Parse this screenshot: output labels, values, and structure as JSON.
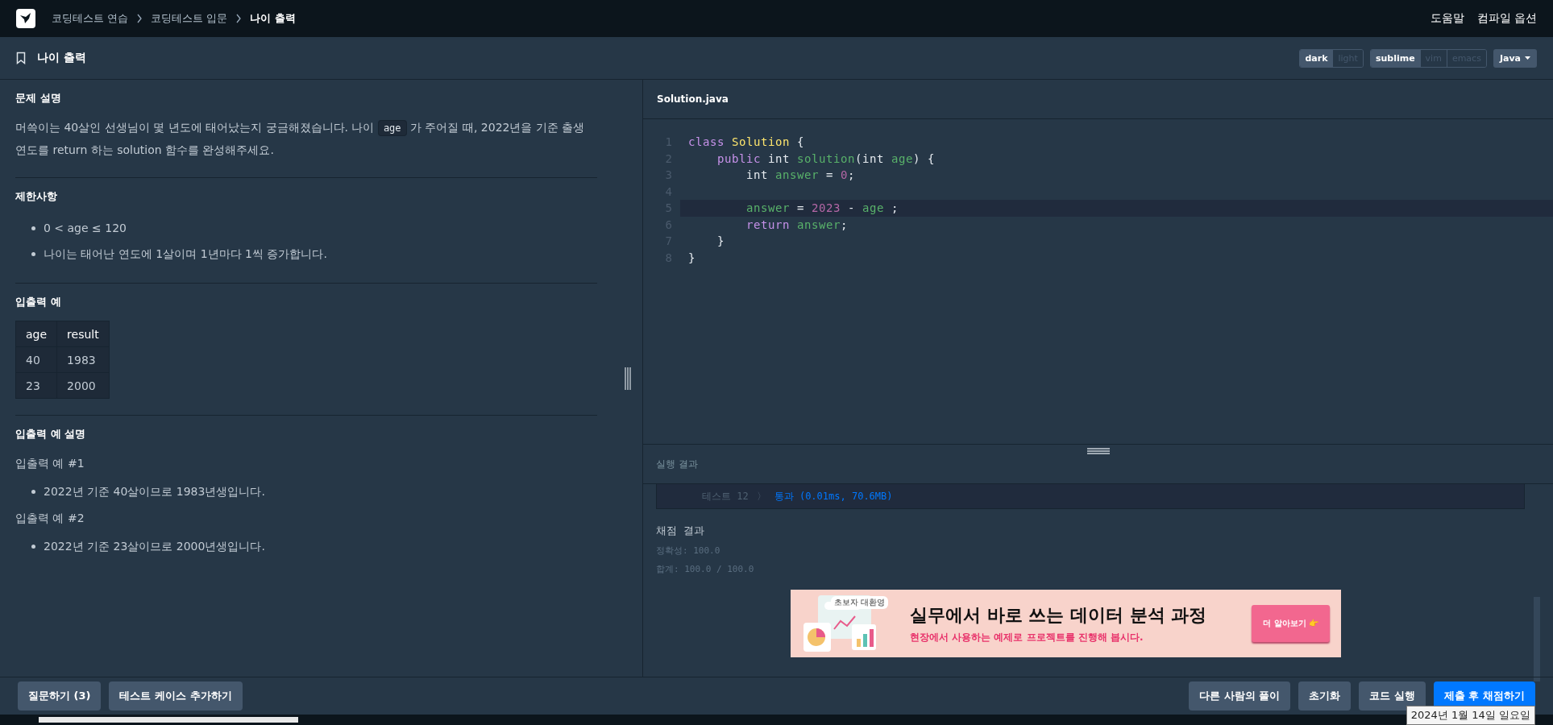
{
  "breadcrumb": [
    {
      "label": "코딩테스트 연습",
      "current": false
    },
    {
      "label": "코딩테스트 입문",
      "current": false
    },
    {
      "label": "나이 출력",
      "current": true
    }
  ],
  "top_links": [
    "도움말",
    "컴파일 옵션"
  ],
  "title": "나이 출력",
  "themes": [
    {
      "label": "dark",
      "selected": true
    },
    {
      "label": "light",
      "selected": false
    }
  ],
  "keymaps": [
    {
      "label": "sublime",
      "selected": true
    },
    {
      "label": "vim",
      "selected": false
    },
    {
      "label": "emacs",
      "selected": false
    }
  ],
  "language": "Java",
  "problem": {
    "sections": [
      {
        "heading": "문제 설명",
        "blocks": [
          {
            "kind": "para",
            "parts": [
              {
                "text": "머쓱이는 40살인 선생님이 몇 년도에 태어났는지 궁금해졌습니다. 나이 "
              },
              {
                "code": "age"
              },
              {
                "text": " 가 주어질 때, 2022년을 기준 출생 연도를 return 하는 solution 함수를 완성해주세요."
              }
            ]
          }
        ]
      },
      {
        "heading": "제한사항",
        "blocks": [
          {
            "kind": "list",
            "items": [
              "0 < age ≤ 120",
              "나이는 태어난 연도에 1살이며 1년마다 1씩 증가합니다."
            ]
          }
        ]
      },
      {
        "heading": "입출력 예",
        "blocks": [
          {
            "kind": "table",
            "columns": [
              "age",
              "result"
            ],
            "rows": [
              [
                "40",
                "1983"
              ],
              [
                "23",
                "2000"
              ]
            ]
          }
        ]
      },
      {
        "heading": "입출력 예 설명",
        "blocks": [
          {
            "kind": "line",
            "text": "입출력 예 #1"
          },
          {
            "kind": "list",
            "items": [
              "2022년 기준 40살이므로 1983년생입니다."
            ]
          },
          {
            "kind": "line",
            "text": "입출력 예 #2"
          },
          {
            "kind": "list",
            "items": [
              "2022년 기준 23살이므로 2000년생입니다."
            ]
          }
        ]
      }
    ]
  },
  "editor": {
    "filename": "Solution.java",
    "lines": [
      {
        "number": "1",
        "highlighted": false,
        "tokens": [
          {
            "t": "class ",
            "color": "#c792ea"
          },
          {
            "t": "Solution",
            "color": "#ffe66d"
          },
          {
            "t": " {",
            "color": "#e6ebf0"
          }
        ]
      },
      {
        "number": "2",
        "highlighted": false,
        "tokens": [
          {
            "t": "    public",
            "color": "#c792ea"
          },
          {
            "t": " int ",
            "color": "#e6ebf0"
          },
          {
            "t": "solution",
            "color": "#59b26a"
          },
          {
            "t": "(int ",
            "color": "#e6ebf0"
          },
          {
            "t": "age",
            "color": "#59b26a"
          },
          {
            "t": ") {",
            "color": "#e6ebf0"
          }
        ]
      },
      {
        "number": "3",
        "highlighted": false,
        "tokens": [
          {
            "t": "        int ",
            "color": "#e6ebf0"
          },
          {
            "t": "answer",
            "color": "#59b26a"
          },
          {
            "t": " = ",
            "color": "#e6ebf0"
          },
          {
            "t": "0",
            "color": "#b467a6"
          },
          {
            "t": ";",
            "color": "#e6ebf0"
          }
        ]
      },
      {
        "number": "4",
        "highlighted": false
      },
      {
        "number": "5",
        "highlighted": true,
        "tokens": [
          {
            "t": "        answer",
            "color": "#59b26a"
          },
          {
            "t": " = ",
            "color": "#e6ebf0"
          },
          {
            "t": "2023",
            "color": "#b467a6"
          },
          {
            "t": " - ",
            "color": "#e6ebf0"
          },
          {
            "t": "age",
            "color": "#59b26a"
          },
          {
            "t": " ;",
            "color": "#e6ebf0"
          }
        ]
      },
      {
        "number": "6",
        "highlighted": false,
        "tokens": [
          {
            "t": "        return",
            "color": "#c792ea"
          },
          {
            "t": " answer",
            "color": "#59b26a"
          },
          {
            "t": ";",
            "color": "#e6ebf0"
          }
        ]
      },
      {
        "number": "7",
        "highlighted": false,
        "tokens": [
          {
            "t": "    }",
            "color": "#e6ebf0"
          }
        ]
      },
      {
        "number": "8",
        "highlighted": false,
        "tokens": [
          {
            "t": "}",
            "color": "#e6ebf0"
          }
        ]
      }
    ]
  },
  "results": {
    "heading": "실행 결과",
    "test": {
      "label": "테스트 12",
      "arrow": "〉",
      "result": "통과 (0.01ms, 70.6MB)"
    },
    "score_title": "채점 결과",
    "accuracy": "정확성: 100.0",
    "total": "합계: 100.0 / 100.0"
  },
  "ad": {
    "search": "초보자 대환영",
    "title": "실무에서 바로 쓰는 데이터 분석 과정",
    "subtitle": "현장에서 사용하는 예제로 프로젝트를 진행해 봅시다.",
    "button": "더 알아보기 👉"
  },
  "bottom_left": [
    "질문하기 (3)",
    "테스트 케이스 추가하기"
  ],
  "bottom_right": [
    {
      "label": "다른 사람의 풀이",
      "primary": false
    },
    {
      "label": "초기화",
      "primary": false
    },
    {
      "label": "코드 실행",
      "primary": false
    },
    {
      "label": "제출 후 채점하기",
      "primary": true
    }
  ],
  "tooltip": "2024년 1월 14일 일요일"
}
